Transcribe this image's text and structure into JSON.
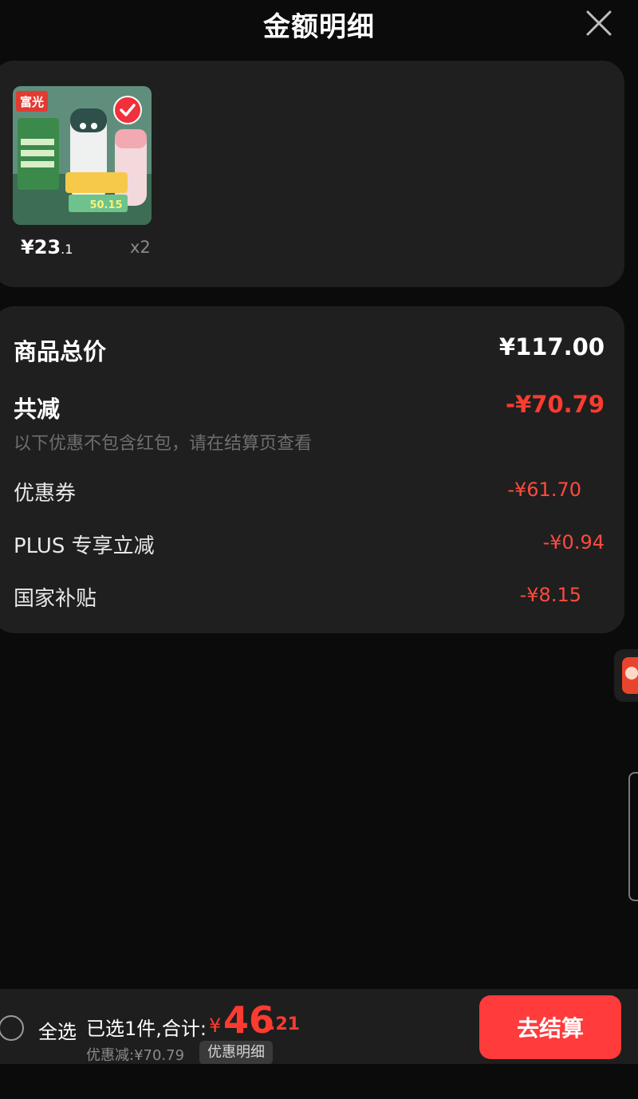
{
  "header": {
    "title": "金额明细"
  },
  "product": {
    "thumb_brand": "富光",
    "thumb_price": "50.15",
    "price_main": "¥23",
    "price_small": ".1",
    "quantity": "x2"
  },
  "summary": {
    "total_label": "商品总价",
    "total_value": "¥117.00",
    "reduce_label": "共减",
    "reduce_value": "-¥70.79",
    "note": "以下优惠不包含红包，请在结算页查看",
    "items": [
      {
        "label": "优惠券",
        "value": "-¥61.70"
      },
      {
        "label": "PLUS 专享立减",
        "value": "-¥0.94"
      },
      {
        "label": "国家补贴",
        "value": "-¥8.15"
      }
    ]
  },
  "bottom": {
    "select_all": "全选",
    "selected_summary": "已选1件,合计:",
    "currency": "¥",
    "total_int": "46",
    "total_dec": ".21",
    "discount": "优惠减:¥70.79",
    "detail_chip": "优惠明细",
    "checkout": "去结算"
  },
  "colors": {
    "accent_red": "#ff3b30",
    "card_bg": "#1f1f1f",
    "page_bg": "#0b0b0b"
  }
}
